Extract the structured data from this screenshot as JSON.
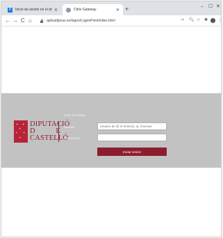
{
  "browser": {
    "tabs": [
      {
        "title": "Inicio de sesión en el dominio scri",
        "favicon": "D",
        "favicon_color": "#1a73e8",
        "close": "✕"
      },
      {
        "title": "Citrix Gateway",
        "favicon": "",
        "favicon_color": "#8a9bb0",
        "close": "✕"
      }
    ],
    "new_tab_icon": "+",
    "window_controls": {
      "minimize": "–",
      "maximize": "☐",
      "close": "✕"
    },
    "nav": {
      "back": "←",
      "forward": "→",
      "reload": "C",
      "home": "⌂"
    },
    "url": "aplicadipcas.es/logon/LogonPoint/index.html",
    "toolbar_icons": {
      "key": "⊸",
      "zoom": "🔍︎",
      "star": "☆",
      "extension": "✱",
      "menu": "⋮"
    }
  },
  "login": {
    "logo": {
      "line1": "DIPUTACIÓ",
      "line2_left": "D",
      "line2_right": "E",
      "line3": "CASTELLÓ"
    },
    "heading": "Inicio de sesión",
    "username_label": "Usuario",
    "username_placeholder": "Usuario de @ el dominio, ej. miusuari",
    "password_label": "Contraseña",
    "password_value": "",
    "submit_label": "Iniciar sesión"
  },
  "colors": {
    "brand": "#8c1d2f",
    "band": "#c2c2c2"
  }
}
